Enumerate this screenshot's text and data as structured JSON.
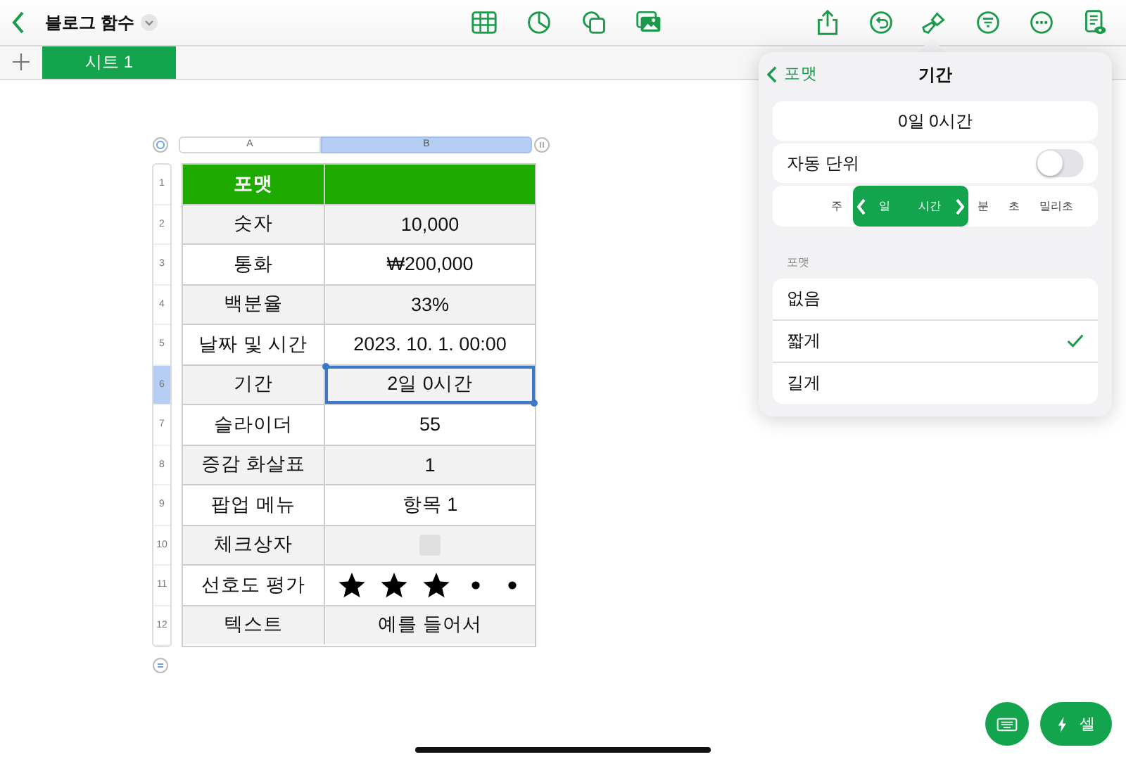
{
  "document": {
    "title": "블로그 함수"
  },
  "sheet_tabs": [
    {
      "label": "시트 1",
      "selected": true
    }
  ],
  "table": {
    "columns": [
      {
        "label": "A",
        "selected": false
      },
      {
        "label": "B",
        "selected": true
      }
    ],
    "rows": [
      {
        "number": "1",
        "selected": false,
        "kind": "header",
        "label": "포맷"
      },
      {
        "number": "2",
        "selected": false,
        "kind": "text",
        "label": "숫자",
        "value": "10,000"
      },
      {
        "number": "3",
        "selected": false,
        "kind": "text",
        "label": "통화",
        "value": "₩200,000"
      },
      {
        "number": "4",
        "selected": false,
        "kind": "text",
        "label": "백분율",
        "value": "33%"
      },
      {
        "number": "5",
        "selected": false,
        "kind": "text",
        "label": "날짜 및 시간",
        "value": "2023. 10. 1. 00:00"
      },
      {
        "number": "6",
        "selected": true,
        "kind": "text",
        "label": "기간",
        "value": "2일 0시간"
      },
      {
        "number": "7",
        "selected": false,
        "kind": "text",
        "label": "슬라이더",
        "value": "55"
      },
      {
        "number": "8",
        "selected": false,
        "kind": "text",
        "label": "증감 화살표",
        "value": "1"
      },
      {
        "number": "9",
        "selected": false,
        "kind": "text",
        "label": "팝업 메뉴",
        "value": "항목 1"
      },
      {
        "number": "10",
        "selected": false,
        "kind": "checkbox",
        "label": "체크상자",
        "checked": false
      },
      {
        "number": "11",
        "selected": false,
        "kind": "stars",
        "label": "선호도 평가",
        "stars": 3
      },
      {
        "number": "12",
        "selected": false,
        "kind": "text",
        "label": "텍스트",
        "value": "예를 들어서"
      }
    ]
  },
  "popover": {
    "back": "포맷",
    "title": "기간",
    "value": "0일 0시간",
    "auto_units": {
      "label": "자동 단위",
      "on": false
    },
    "units": [
      {
        "label": "주",
        "selected": false
      },
      {
        "label": "일",
        "selected": true
      },
      {
        "label": "시간",
        "selected": true
      },
      {
        "label": "분",
        "selected": false
      },
      {
        "label": "초",
        "selected": false
      },
      {
        "label": "밀리초",
        "selected": false
      }
    ],
    "section": "포맷",
    "formats": [
      {
        "label": "없음",
        "selected": false
      },
      {
        "label": "짧게",
        "selected": true
      },
      {
        "label": "길게",
        "selected": false
      }
    ]
  },
  "cell_button": "셀"
}
